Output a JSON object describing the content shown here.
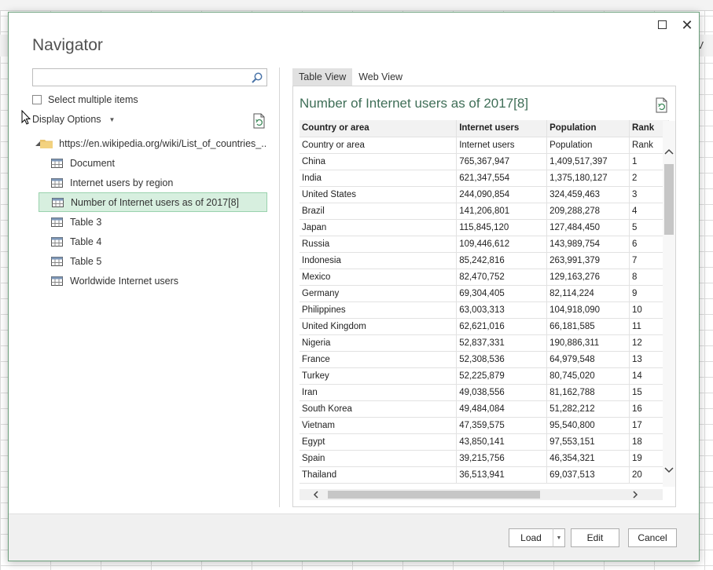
{
  "excel": {
    "column_letter": "V"
  },
  "dialog": {
    "title": "Navigator",
    "search": {
      "placeholder": "",
      "value": ""
    },
    "select_multiple_label": "Select multiple items",
    "display_options_label": "Display Options",
    "tree": {
      "root": "https://en.wikipedia.org/wiki/List_of_countries_...",
      "items": [
        {
          "label": "Document",
          "selected": false
        },
        {
          "label": "Internet users by region",
          "selected": false
        },
        {
          "label": "Number of Internet users as of 2017[8]",
          "selected": true
        },
        {
          "label": "Table 3",
          "selected": false
        },
        {
          "label": "Table 4",
          "selected": false
        },
        {
          "label": "Table 5",
          "selected": false
        },
        {
          "label": "Worldwide Internet users",
          "selected": false
        }
      ]
    },
    "tabs": [
      {
        "label": "Table View",
        "active": true
      },
      {
        "label": "Web View",
        "active": false
      }
    ],
    "preview_title": "Number of Internet users as of 2017[8]",
    "table": {
      "columns": [
        "Country or area",
        "Internet users",
        "Population",
        "Rank"
      ],
      "rows": [
        [
          "Country or area",
          "Internet users",
          "Population",
          "Rank"
        ],
        [
          "China",
          "765,367,947",
          "1,409,517,397",
          "1"
        ],
        [
          "India",
          "621,347,554",
          "1,375,180,127",
          "2"
        ],
        [
          "United States",
          "244,090,854",
          "324,459,463",
          "3"
        ],
        [
          "Brazil",
          "141,206,801",
          "209,288,278",
          "4"
        ],
        [
          "Japan",
          "115,845,120",
          "127,484,450",
          "5"
        ],
        [
          "Russia",
          "109,446,612",
          "143,989,754",
          "6"
        ],
        [
          "Indonesia",
          "85,242,816",
          "263,991,379",
          "7"
        ],
        [
          "Mexico",
          "82,470,752",
          "129,163,276",
          "8"
        ],
        [
          "Germany",
          "69,304,405",
          "82,114,224",
          "9"
        ],
        [
          "Philippines",
          "63,003,313",
          "104,918,090",
          "10"
        ],
        [
          "United Kingdom",
          "62,621,016",
          "66,181,585",
          "11"
        ],
        [
          "Nigeria",
          "52,837,331",
          "190,886,311",
          "12"
        ],
        [
          "France",
          "52,308,536",
          "64,979,548",
          "13"
        ],
        [
          "Turkey",
          "52,225,879",
          "80,745,020",
          "14"
        ],
        [
          "Iran",
          "49,038,556",
          "81,162,788",
          "15"
        ],
        [
          "South Korea",
          "49,484,084",
          "51,282,212",
          "16"
        ],
        [
          "Vietnam",
          "47,359,575",
          "95,540,800",
          "17"
        ],
        [
          "Egypt",
          "43,850,141",
          "97,553,151",
          "18"
        ],
        [
          "Spain",
          "39,215,756",
          "46,354,321",
          "19"
        ],
        [
          "Thailand",
          "36,513,941",
          "69,037,513",
          "20"
        ]
      ]
    },
    "buttons": {
      "load": "Load",
      "edit": "Edit",
      "cancel": "Cancel"
    },
    "colors": {
      "accent": "#3f6e57",
      "selection": "#d7efdf",
      "selection_border": "#9ad2ad"
    }
  }
}
